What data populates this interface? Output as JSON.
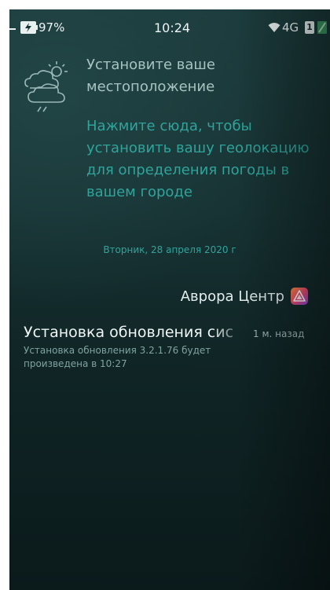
{
  "status_bar": {
    "battery": "97%",
    "time": "10:24",
    "network": "4G",
    "sim": "1"
  },
  "weather": {
    "title": "Установите ваше местоположение",
    "hint": "Нажмите сюда, чтобы установить вашу геолокацию для определения погоды в вашем городе"
  },
  "date": "Вторник, 28 апреля 2020 г",
  "aurora_center": {
    "label": "Аврора Центр"
  },
  "notification": {
    "title": "Установка обновления сис",
    "time": "1 м. назад",
    "body": "Установка обновления 3.2.1.76 будет произведена в 10:27"
  },
  "colors": {
    "background": "#173233",
    "accent": "#2fa49a",
    "text_primary": "#e6eeee",
    "text_muted": "#7fa3a2"
  },
  "icons": [
    "battery-icon",
    "wifi-icon",
    "charge-icon",
    "weather-icon",
    "aurora-icon"
  ]
}
